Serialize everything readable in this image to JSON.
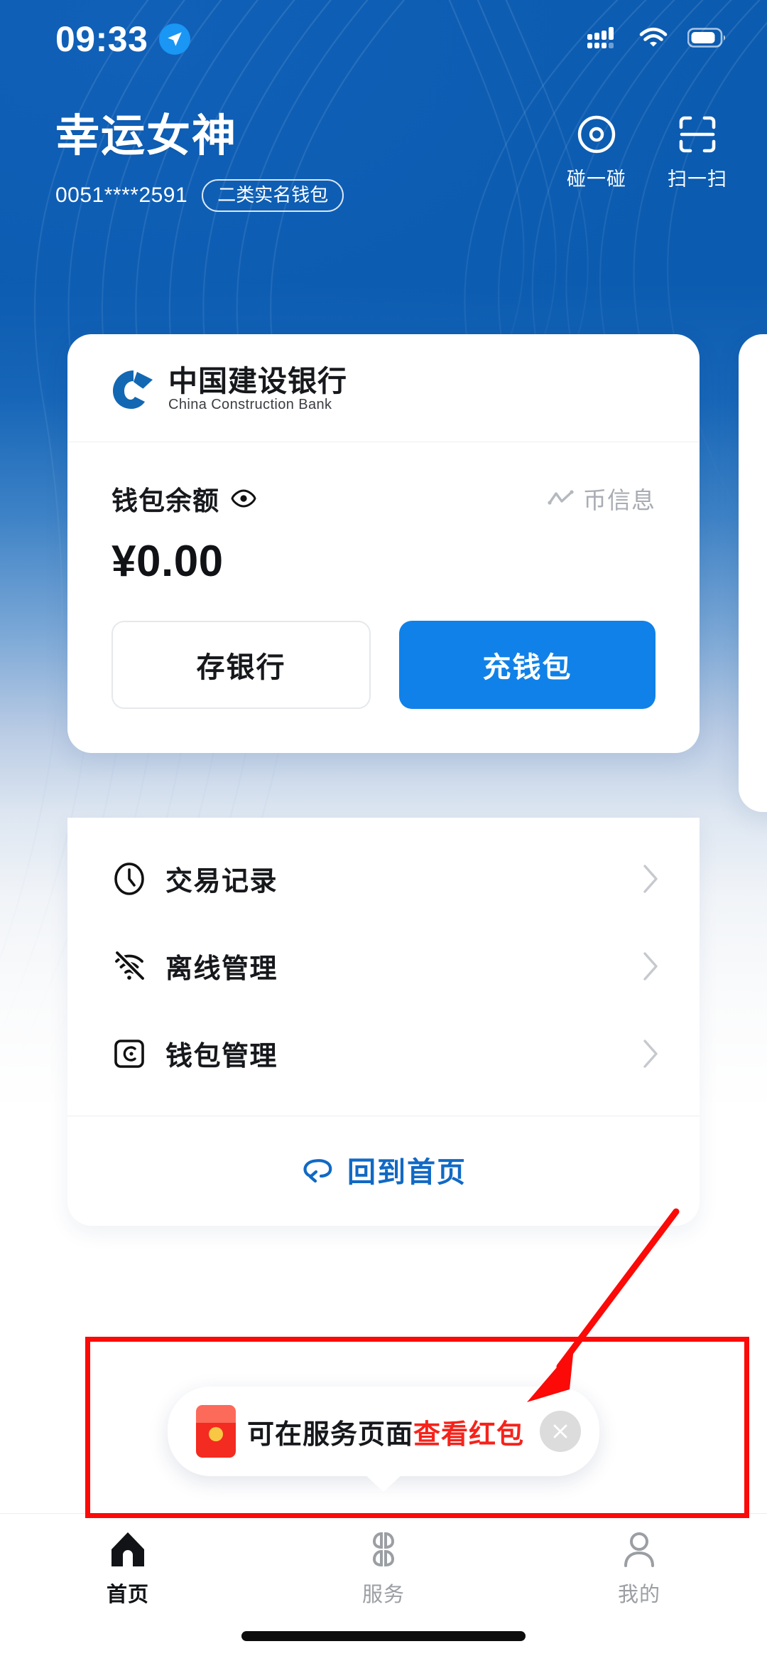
{
  "status_bar": {
    "time": "09:33",
    "location_icon": "navigation-arrow-icon",
    "signal_icon": "cellular-signal-icon",
    "wifi_icon": "wifi-icon",
    "battery_icon": "battery-icon",
    "icon_color": "#ffffff",
    "location_badge_color": "#1a96f5"
  },
  "header": {
    "title": "幸运女神",
    "account": "0051****2591",
    "badge": "二类实名钱包",
    "actions": [
      {
        "label": "碰一碰",
        "icon": "nfc-touch-icon"
      },
      {
        "label": "扫一扫",
        "icon": "scan-qr-icon"
      }
    ]
  },
  "wallet_card": {
    "bank_name_cn": "中国建设银行",
    "bank_name_en": "China Construction Bank",
    "bank_logo_icon": "ccb-logo-icon",
    "bank_logo_color": "#1268b3",
    "balance_label": "钱包余额",
    "balance_eye_icon": "eye-visibility-icon",
    "coin_info_label": "币信息",
    "coin_info_icon": "trend-chart-icon",
    "balance_amount": "¥0.00",
    "buttons": [
      {
        "label": "存银行",
        "style": "outline"
      },
      {
        "label": "充钱包",
        "style": "primary"
      }
    ],
    "primary_color": "#1081e8"
  },
  "menu": {
    "items": [
      {
        "label": "交易记录",
        "icon": "clock-history-icon",
        "chevron": "chevron-right-icon"
      },
      {
        "label": "离线管理",
        "icon": "wifi-offline-icon",
        "chevron": "chevron-right-icon"
      },
      {
        "label": "钱包管理",
        "icon": "wallet-manage-icon",
        "chevron": "chevron-right-icon"
      }
    ],
    "home_link": {
      "label": "回到首页",
      "icon": "return-arrow-icon",
      "color": "#1169c4"
    }
  },
  "toast": {
    "icon": "red-envelope-icon",
    "text_normal": "可在服务页面",
    "text_highlight": "查看红包",
    "highlight_color": "#f5231b",
    "close_icon": "close-x-icon"
  },
  "annotation": {
    "box_color": "#fb0a07",
    "arrow_icon": "annotation-arrow-icon"
  },
  "tabbar": {
    "tabs": [
      {
        "label": "首页",
        "icon": "home-icon",
        "active": true
      },
      {
        "label": "服务",
        "icon": "services-grid-icon",
        "active": false
      },
      {
        "label": "我的",
        "icon": "profile-person-icon",
        "active": false
      }
    ],
    "active_color": "#111316",
    "inactive_color": "#9b9ea3"
  }
}
